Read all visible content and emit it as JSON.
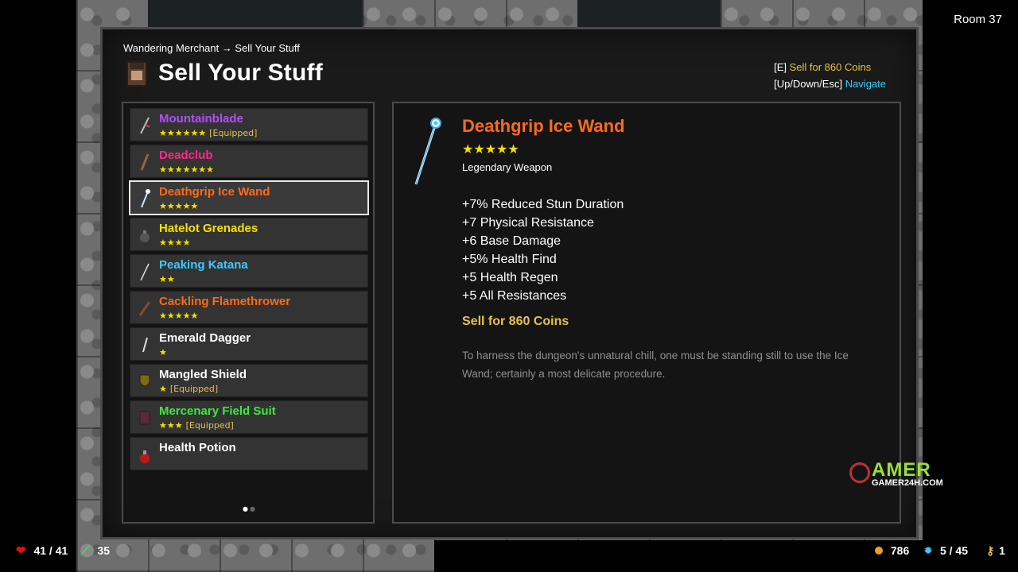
{
  "room": "Room 37",
  "breadcrumb": "Wandering Merchant → Sell Your Stuff",
  "title": "Sell Your Stuff",
  "hints": {
    "sell_key": "[E]",
    "sell_label": "Sell for 860 Coins",
    "nav_key": "[Up/Down/Esc]",
    "nav_label": "Navigate"
  },
  "items": [
    {
      "name": "Mountainblade",
      "stars": "★★★★★★",
      "equipped": "[Equipped]",
      "color": "#b44cff",
      "icon": "sword-icon"
    },
    {
      "name": "Deadclub",
      "stars": "★★★★★★★",
      "equipped": "",
      "color": "#ff2a8a",
      "icon": "club-icon"
    },
    {
      "name": "Deathgrip Ice Wand",
      "stars": "★★★★★",
      "equipped": "",
      "color": "#ff6a1a",
      "icon": "wand-icon"
    },
    {
      "name": "Hatelot Grenades",
      "stars": "★★★★",
      "equipped": "",
      "color": "#f5e000",
      "icon": "grenade-icon"
    },
    {
      "name": "Peaking Katana",
      "stars": "★★",
      "equipped": "",
      "color": "#3ec8ff",
      "icon": "katana-icon"
    },
    {
      "name": "Cackling Flamethrower",
      "stars": "★★★★★",
      "equipped": "",
      "color": "#ff6a1a",
      "icon": "flamethrower-icon"
    },
    {
      "name": "Emerald Dagger",
      "stars": "★",
      "equipped": "",
      "color": "#ffffff",
      "icon": "dagger-icon"
    },
    {
      "name": "Mangled Shield",
      "stars": "★",
      "equipped": "[Equipped]",
      "color": "#ffffff",
      "icon": "shield-icon"
    },
    {
      "name": "Mercenary Field Suit",
      "stars": "★★★",
      "equipped": "[Equipped]",
      "color": "#3ee83e",
      "icon": "armor-icon"
    },
    {
      "name": "Health Potion",
      "stars": "",
      "equipped": "",
      "color": "#ffffff",
      "icon": "potion-icon"
    }
  ],
  "selected_index": 2,
  "page_dots": "••",
  "detail": {
    "name": "Deathgrip Ice Wand",
    "stars": "★★★★★",
    "type": "Legendary Weapon",
    "stats": [
      "+7% Reduced Stun Duration",
      "+7 Physical Resistance",
      "+6 Base Damage",
      "+5% Health Find",
      "+5 Health Regen",
      "+5 All Resistances"
    ],
    "sell": "Sell for 860 Coins",
    "flavor": "To harness the dungeon's unnatural chill, one must be standing still to use the Ice Wand; certainly a most delicate procedure."
  },
  "watermark": {
    "big": "AMER",
    "small": "GAMER24H.COM"
  },
  "hud": {
    "health": "41 / 41",
    "attack": "35",
    "coins": "786",
    "gems": "5 / 45",
    "keys": "1"
  }
}
